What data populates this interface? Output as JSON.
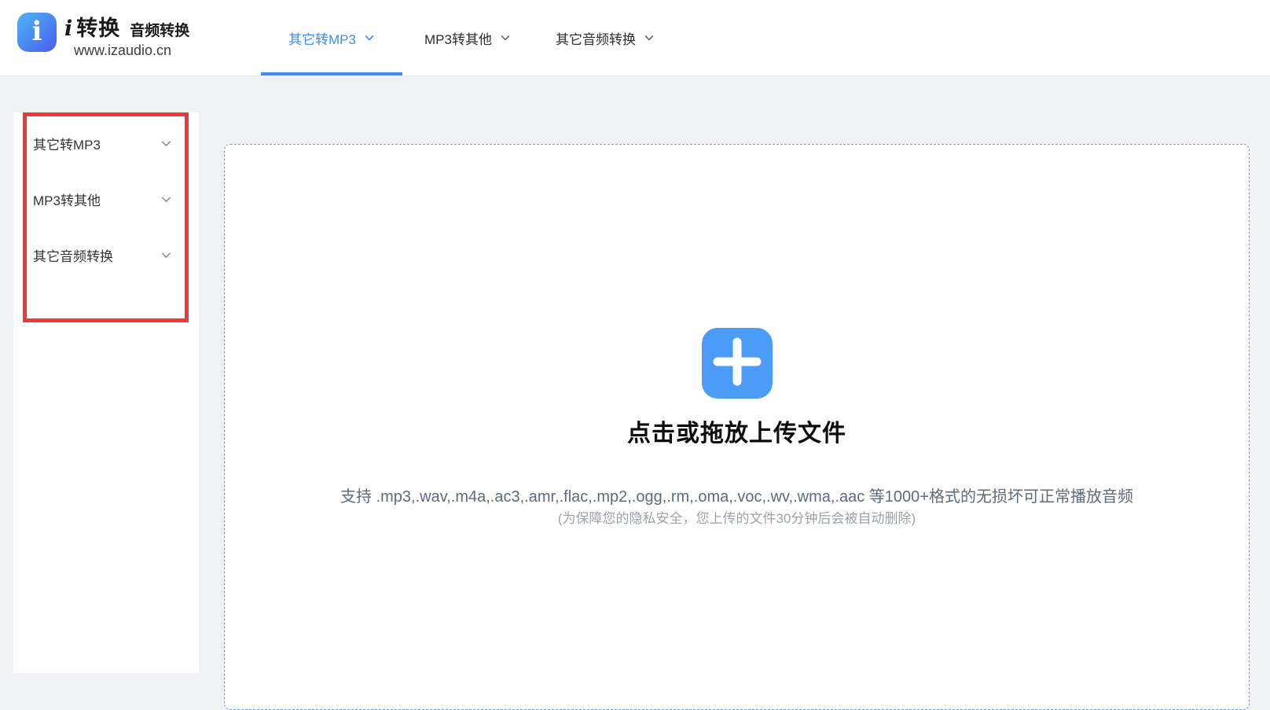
{
  "brand": {
    "logo_letter": "i",
    "name_prefix": "i",
    "name": "转换",
    "subtitle": "音频转换",
    "url": "www.izaudio.cn"
  },
  "nav": {
    "tabs": [
      {
        "label": "其它转MP3",
        "active": true
      },
      {
        "label": "MP3转其他",
        "active": false
      },
      {
        "label": "其它音频转换",
        "active": false
      }
    ]
  },
  "sidebar": {
    "items": [
      {
        "label": "其它转MP3"
      },
      {
        "label": "MP3转其他"
      },
      {
        "label": "其它音频转换"
      }
    ]
  },
  "upload": {
    "title": "点击或拖放上传文件",
    "support_text": "支持 .mp3,.wav,.m4a,.ac3,.amr,.flac,.mp2,.ogg,.rm,.oma,.voc,.wv,.wma,.aac 等1000+格式的无损坏可正常播放音频",
    "privacy_text": "(为保障您的隐私安全，您上传的文件30分钟后会被自动删除)"
  },
  "colors": {
    "accent_blue": "#3d8df5",
    "plus_button_blue": "#4b9cf6",
    "dashed_border_blue": "#57a0ee",
    "annotation_red": "#f73535",
    "page_background": "#f0f2f6"
  }
}
